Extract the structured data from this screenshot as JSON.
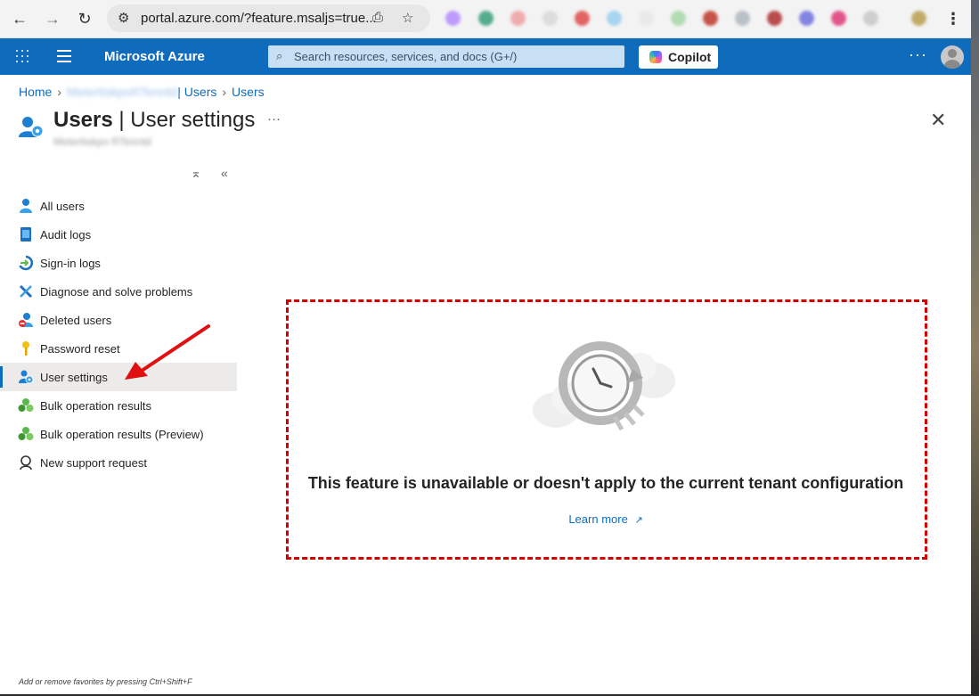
{
  "browser": {
    "url": "portal.azure.com/?feature.msaljs=true..."
  },
  "header": {
    "title": "Microsoft Azure",
    "search_placeholder": "Search resources, services, and docs (G+/)",
    "copilot_label": "Copilot",
    "more_label": "···"
  },
  "breadcrumb": {
    "home": "Home",
    "tenant_suffix": "| Users",
    "last": "Users"
  },
  "page": {
    "title_main": "Users",
    "title_sep": " | ",
    "title_sub": "User settings",
    "more_label": "···",
    "close_label": "✕"
  },
  "sidebar": {
    "collapse_label": "«",
    "expand_label": "⌅",
    "items": [
      {
        "label": "All users",
        "icon": "user-icon"
      },
      {
        "label": "Audit logs",
        "icon": "audit-log-icon"
      },
      {
        "label": "Sign-in logs",
        "icon": "sign-in-icon"
      },
      {
        "label": "Diagnose and solve problems",
        "icon": "wrench-icon"
      },
      {
        "label": "Deleted users",
        "icon": "deleted-user-icon"
      },
      {
        "label": "Password reset",
        "icon": "key-icon"
      },
      {
        "label": "User settings",
        "icon": "user-settings-icon"
      },
      {
        "label": "Bulk operation results",
        "icon": "bulk-icon"
      },
      {
        "label": "Bulk operation results (Preview)",
        "icon": "bulk-icon"
      },
      {
        "label": "New support request",
        "icon": "support-icon"
      }
    ],
    "active_index": 6,
    "footer_hint": "Add or remove favorites by pressing Ctrl+Shift+F"
  },
  "content": {
    "message": "This feature is unavailable or doesn't apply to the current tenant configuration",
    "learn_more": "Learn more"
  },
  "colors": {
    "azure_blue": "#0f6cbd",
    "annotation_red": "#d40000"
  }
}
